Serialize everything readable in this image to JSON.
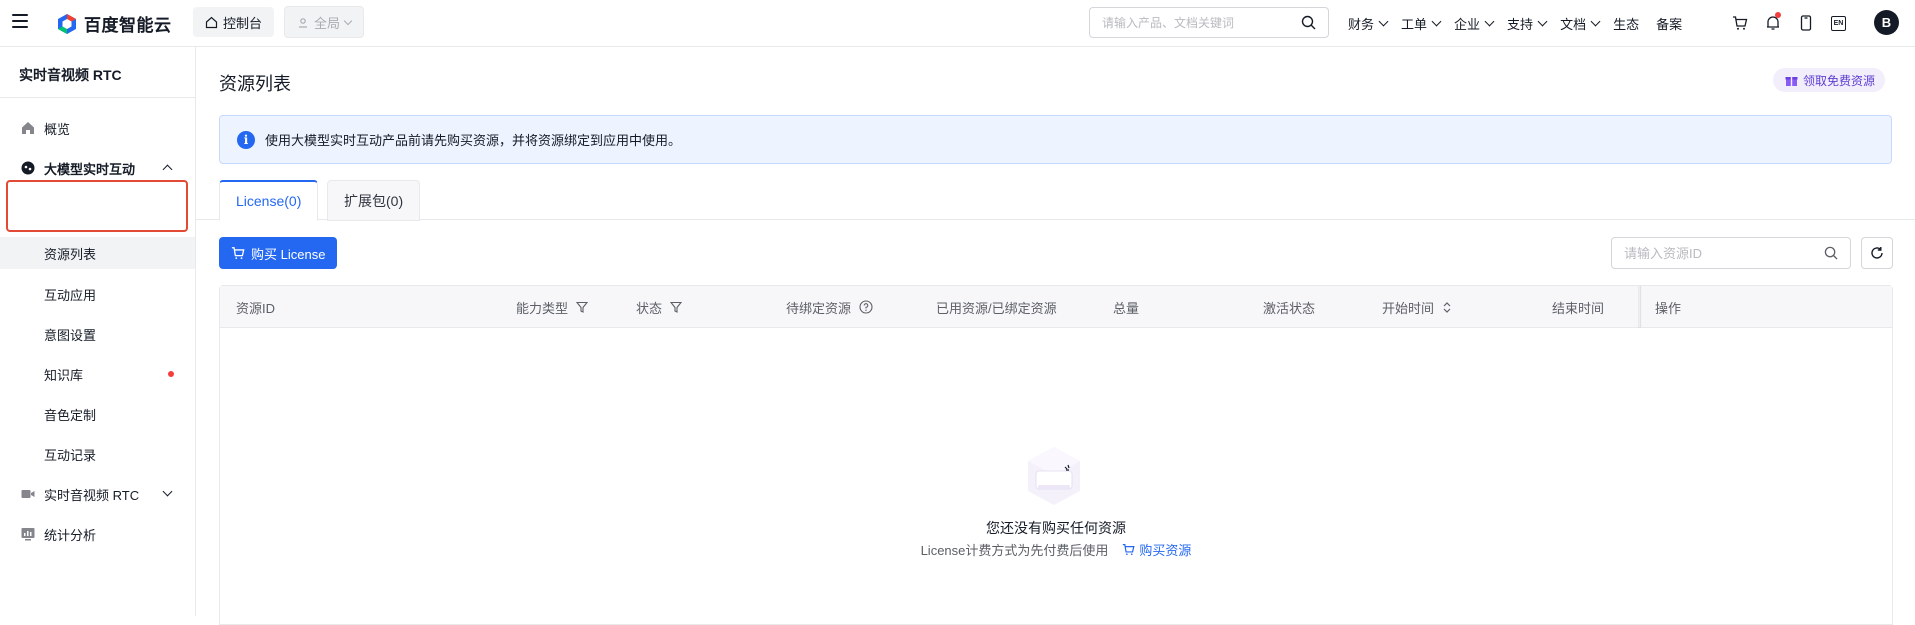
{
  "topbar": {
    "logo_text": "百度智能云",
    "console_label": "控制台",
    "region_label": "全局",
    "search_placeholder": "请输入产品、文档关键词",
    "nav": [
      "财务",
      "工单",
      "企业",
      "支持",
      "文档"
    ],
    "nav_plain": [
      "生态",
      "备案"
    ],
    "lang_icon_text": "EN",
    "avatar_letter": "B"
  },
  "sidebar": {
    "title": "实时音视频 RTC",
    "items": {
      "overview": "概览",
      "llm_interaction": "大模型实时互动",
      "resource_list": "资源列表",
      "apps": "互动应用",
      "intent": "意图设置",
      "kb": "知识库",
      "voice": "音色定制",
      "records": "互动记录",
      "rtc": "实时音视频 RTC",
      "stats": "统计分析"
    }
  },
  "main": {
    "title": "资源列表",
    "free_label": "领取免费资源",
    "notice": "使用大模型实时互动产品前请先购买资源，并将资源绑定到应用中使用。",
    "tabs": [
      "License(0)",
      "扩展包(0)"
    ],
    "buy_label": "购买 License",
    "search_placeholder": "请输入资源ID",
    "columns": [
      "资源ID",
      "能力类型",
      "状态",
      "待绑定资源",
      "已用资源/已绑定资源",
      "总量",
      "激活状态",
      "开始时间",
      "结束时间",
      "操作"
    ],
    "empty_title": "您还没有购买任何资源",
    "empty_desc": "License计费方式为先付费后使用",
    "empty_link": "购买资源"
  },
  "colors": {
    "primary": "#2468f2",
    "highlight": "#e34a35",
    "dot": "#f33e3e"
  }
}
